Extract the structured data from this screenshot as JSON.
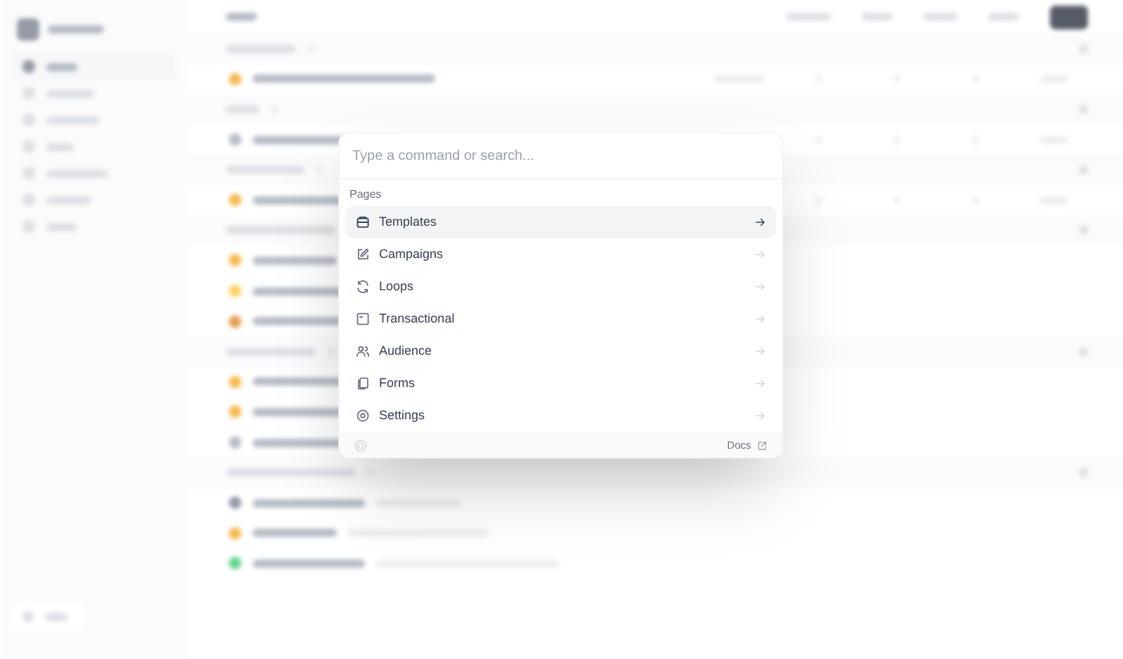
{
  "command": {
    "placeholder": "Type a command or search...",
    "group": "Pages",
    "items": [
      {
        "label": "Templates",
        "selected": true
      },
      {
        "label": "Campaigns",
        "selected": false
      },
      {
        "label": "Loops",
        "selected": false
      },
      {
        "label": "Transactional",
        "selected": false
      },
      {
        "label": "Audience",
        "selected": false
      },
      {
        "label": "Forms",
        "selected": false
      },
      {
        "label": "Settings",
        "selected": false
      }
    ],
    "docs": "Docs"
  }
}
